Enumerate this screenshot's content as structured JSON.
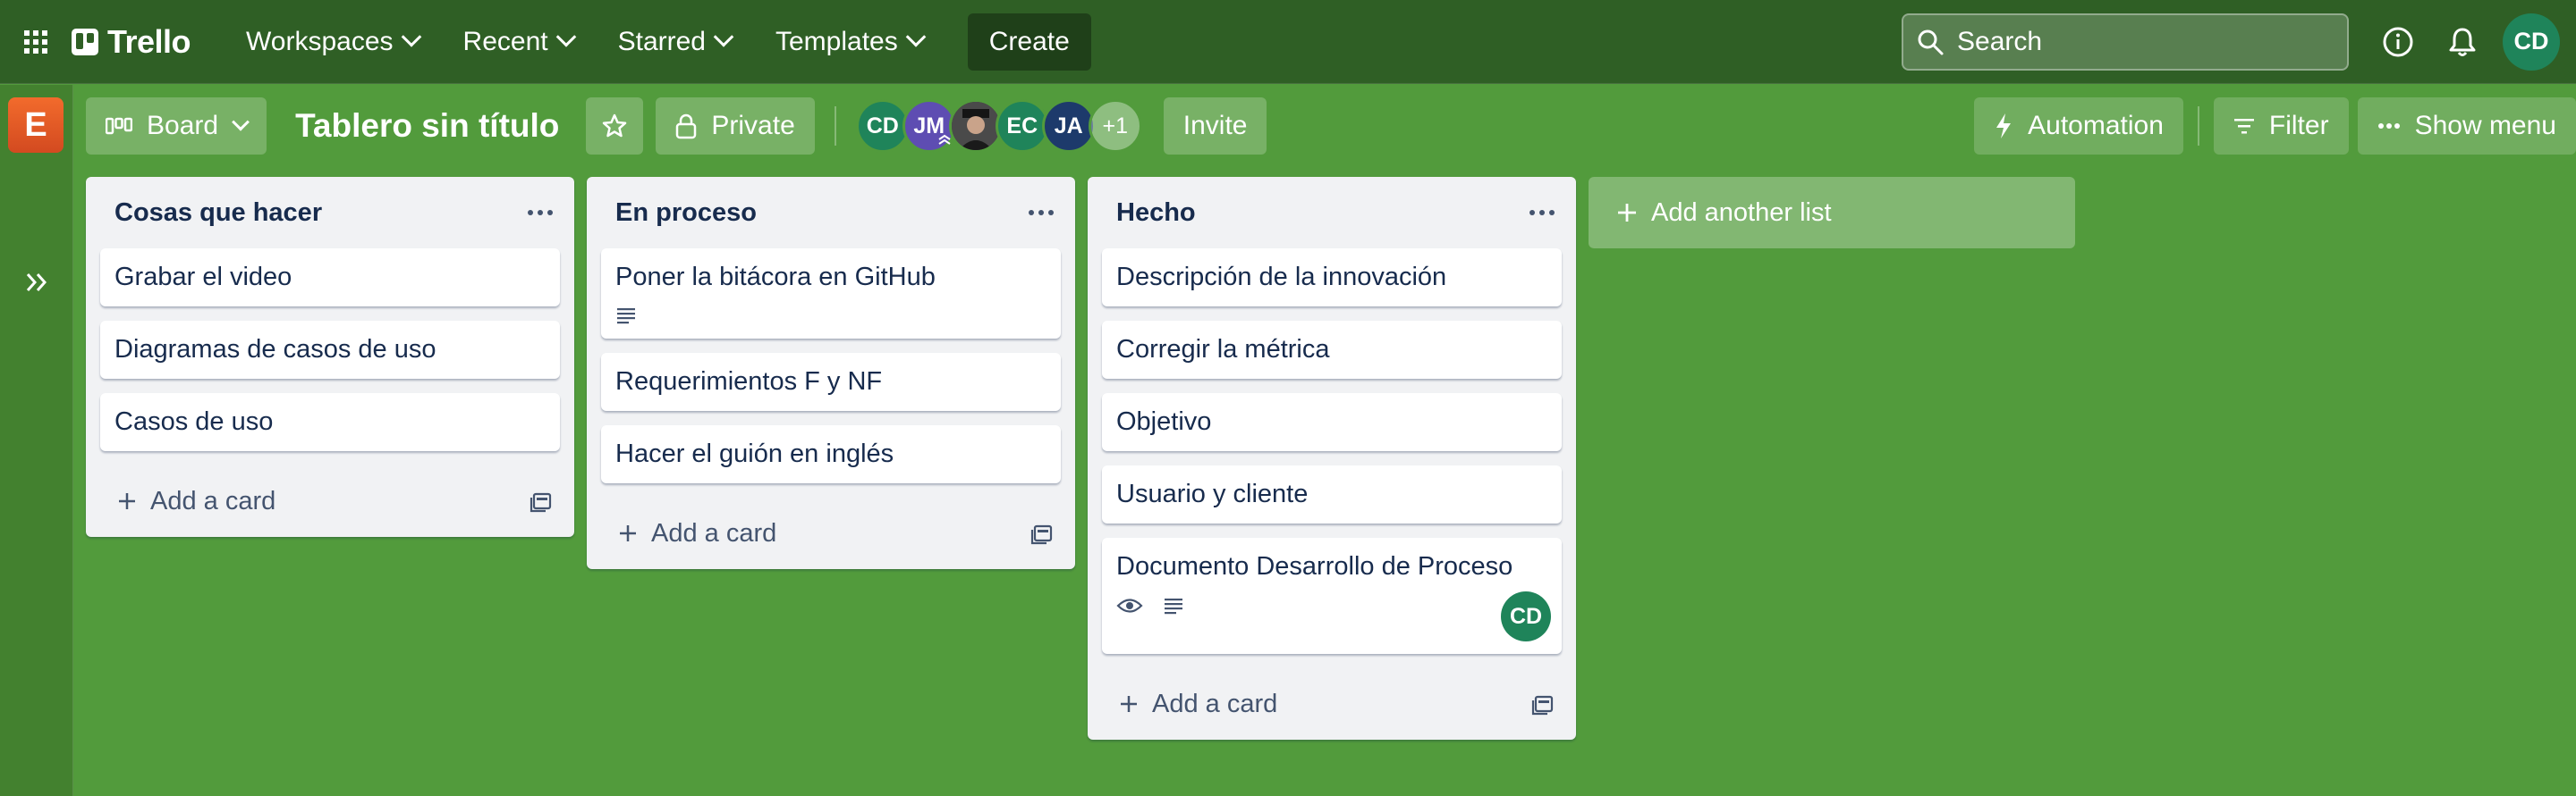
{
  "nav": {
    "logo_text": "Trello",
    "menus": [
      {
        "label": "Workspaces"
      },
      {
        "label": "Recent"
      },
      {
        "label": "Starred"
      },
      {
        "label": "Templates"
      }
    ],
    "create_label": "Create",
    "search_placeholder": "Search",
    "user_initials": "CD"
  },
  "workspace": {
    "initial": "E"
  },
  "board": {
    "view_label": "Board",
    "title": "Tablero sin título",
    "visibility_label": "Private",
    "members": [
      {
        "initials": "CD",
        "color": "#1f845a"
      },
      {
        "initials": "JM",
        "color": "#5e4db2"
      },
      {
        "initials": "",
        "color": "#3b3b3b"
      },
      {
        "initials": "EC",
        "color": "#1f845a"
      },
      {
        "initials": "JA",
        "color": "#1d3a6b"
      }
    ],
    "more_members": "+1",
    "invite_label": "Invite",
    "automation_label": "Automation",
    "filter_label": "Filter",
    "show_menu_label": "Show menu"
  },
  "lists": [
    {
      "title": "Cosas que hacer",
      "cards": [
        {
          "title": "Grabar el video"
        },
        {
          "title": "Diagramas de casos de uso"
        },
        {
          "title": "Casos de uso"
        }
      ],
      "add_card_label": "Add a card"
    },
    {
      "title": "En proceso",
      "cards": [
        {
          "title": "Poner la bitácora en GitHub",
          "has_description": true
        },
        {
          "title": "Requerimientos F y NF"
        },
        {
          "title": "Hacer el guión en inglés"
        }
      ],
      "add_card_label": "Add a card"
    },
    {
      "title": "Hecho",
      "cards": [
        {
          "title": "Descripción de la innovación"
        },
        {
          "title": "Corregir la métrica"
        },
        {
          "title": "Objetivo"
        },
        {
          "title": "Usuario y cliente"
        },
        {
          "title": "Documento Desarrollo de Proceso",
          "watching": true,
          "has_description": true,
          "member": "CD"
        }
      ],
      "add_card_label": "Add a card"
    }
  ],
  "add_list_label": "Add another list"
}
